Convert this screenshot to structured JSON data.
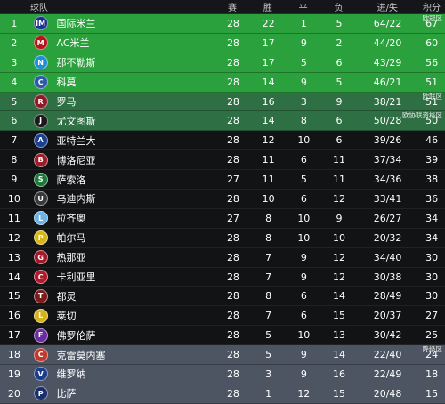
{
  "header": {
    "team": "球队",
    "played": "赛",
    "win": "胜",
    "draw": "平",
    "loss": "负",
    "goals": "进/失",
    "points": "积分"
  },
  "rows": [
    {
      "rank": "1",
      "team": "国际米兰",
      "p": "28",
      "w": "22",
      "d": "1",
      "l": "5",
      "gd": "64/22",
      "pts": "67",
      "zone": "cl",
      "tag": "欧冠区",
      "badge_color": "#1b2f8f",
      "badge_icon": "inter-badge-icon",
      "badge_glyph": "IM"
    },
    {
      "rank": "2",
      "team": "AC米兰",
      "p": "28",
      "w": "17",
      "d": "9",
      "l": "2",
      "gd": "44/20",
      "pts": "60",
      "zone": "cl",
      "tag": "",
      "badge_color": "#b3151b",
      "badge_icon": "milan-badge-icon",
      "badge_glyph": "M"
    },
    {
      "rank": "3",
      "team": "那不勒斯",
      "p": "28",
      "w": "17",
      "d": "5",
      "l": "6",
      "gd": "43/29",
      "pts": "56",
      "zone": "cl",
      "tag": "",
      "badge_color": "#1e8fd6",
      "badge_icon": "napoli-badge-icon",
      "badge_glyph": "N"
    },
    {
      "rank": "4",
      "team": "科莫",
      "p": "28",
      "w": "14",
      "d": "9",
      "l": "5",
      "gd": "46/21",
      "pts": "51",
      "zone": "cl",
      "tag": "",
      "badge_color": "#2a5aa8",
      "badge_icon": "como-badge-icon",
      "badge_glyph": "C"
    },
    {
      "rank": "5",
      "team": "罗马",
      "p": "28",
      "w": "16",
      "d": "3",
      "l": "9",
      "gd": "38/21",
      "pts": "51",
      "zone": "el",
      "tag": "欧联区",
      "badge_color": "#8c1c2a",
      "badge_icon": "roma-badge-icon",
      "badge_glyph": "R"
    },
    {
      "rank": "6",
      "team": "尤文图斯",
      "p": "28",
      "w": "14",
      "d": "8",
      "l": "6",
      "gd": "50/28",
      "pts": "50",
      "zone": "el",
      "tag": "欧协联资格区",
      "badge_color": "#1a1a1a",
      "badge_icon": "juventus-badge-icon",
      "badge_glyph": "J"
    },
    {
      "rank": "7",
      "team": "亚特兰大",
      "p": "28",
      "w": "12",
      "d": "10",
      "l": "6",
      "gd": "39/26",
      "pts": "46",
      "zone": "mid",
      "tag": "",
      "badge_color": "#1d3f8f",
      "badge_icon": "atalanta-badge-icon",
      "badge_glyph": "A"
    },
    {
      "rank": "8",
      "team": "博洛尼亚",
      "p": "28",
      "w": "11",
      "d": "6",
      "l": "11",
      "gd": "37/34",
      "pts": "39",
      "zone": "mid",
      "tag": "",
      "badge_color": "#9c1d2a",
      "badge_icon": "bologna-badge-icon",
      "badge_glyph": "B"
    },
    {
      "rank": "9",
      "team": "萨索洛",
      "p": "27",
      "w": "11",
      "d": "5",
      "l": "11",
      "gd": "34/36",
      "pts": "38",
      "zone": "mid",
      "tag": "",
      "badge_color": "#1d7a3a",
      "badge_icon": "sassuolo-badge-icon",
      "badge_glyph": "S"
    },
    {
      "rank": "10",
      "team": "乌迪内斯",
      "p": "28",
      "w": "10",
      "d": "6",
      "l": "12",
      "gd": "33/41",
      "pts": "36",
      "zone": "mid",
      "tag": "",
      "badge_color": "#3a3a3a",
      "badge_icon": "udinese-badge-icon",
      "badge_glyph": "U"
    },
    {
      "rank": "11",
      "team": "拉齐奥",
      "p": "27",
      "w": "8",
      "d": "10",
      "l": "9",
      "gd": "26/27",
      "pts": "34",
      "zone": "mid",
      "tag": "",
      "badge_color": "#6bb3e6",
      "badge_icon": "lazio-badge-icon",
      "badge_glyph": "L"
    },
    {
      "rank": "12",
      "team": "帕尔马",
      "p": "28",
      "w": "8",
      "d": "10",
      "l": "10",
      "gd": "20/32",
      "pts": "34",
      "zone": "mid",
      "tag": "",
      "badge_color": "#d9b51a",
      "badge_icon": "parma-badge-icon",
      "badge_glyph": "P"
    },
    {
      "rank": "13",
      "team": "热那亚",
      "p": "28",
      "w": "7",
      "d": "9",
      "l": "12",
      "gd": "34/40",
      "pts": "30",
      "zone": "mid",
      "tag": "",
      "badge_color": "#a3182a",
      "badge_icon": "genoa-badge-icon",
      "badge_glyph": "G"
    },
    {
      "rank": "14",
      "team": "卡利亚里",
      "p": "28",
      "w": "7",
      "d": "9",
      "l": "12",
      "gd": "30/38",
      "pts": "30",
      "zone": "mid",
      "tag": "",
      "badge_color": "#b01a2a",
      "badge_icon": "cagliari-badge-icon",
      "badge_glyph": "C"
    },
    {
      "rank": "15",
      "team": "都灵",
      "p": "28",
      "w": "8",
      "d": "6",
      "l": "14",
      "gd": "28/49",
      "pts": "30",
      "zone": "mid",
      "tag": "",
      "badge_color": "#7a1c1c",
      "badge_icon": "torino-badge-icon",
      "badge_glyph": "T"
    },
    {
      "rank": "16",
      "team": "莱切",
      "p": "28",
      "w": "7",
      "d": "6",
      "l": "15",
      "gd": "20/37",
      "pts": "27",
      "zone": "mid",
      "tag": "",
      "badge_color": "#d7b21c",
      "badge_icon": "lecce-badge-icon",
      "badge_glyph": "L"
    },
    {
      "rank": "17",
      "team": "佛罗伦萨",
      "p": "28",
      "w": "5",
      "d": "10",
      "l": "13",
      "gd": "30/42",
      "pts": "25",
      "zone": "mid",
      "tag": "",
      "badge_color": "#6b2ca3",
      "badge_icon": "fiorentina-badge-icon",
      "badge_glyph": "F"
    },
    {
      "rank": "18",
      "team": "克雷莫内塞",
      "p": "28",
      "w": "5",
      "d": "9",
      "l": "14",
      "gd": "22/40",
      "pts": "24",
      "zone": "rel",
      "tag": "降级区",
      "badge_color": "#c2392b",
      "badge_icon": "cremonese-badge-icon",
      "badge_glyph": "C"
    },
    {
      "rank": "19",
      "team": "维罗纳",
      "p": "28",
      "w": "3",
      "d": "9",
      "l": "16",
      "gd": "22/49",
      "pts": "18",
      "zone": "rel",
      "tag": "",
      "badge_color": "#1b3d8c",
      "badge_icon": "verona-badge-icon",
      "badge_glyph": "V"
    },
    {
      "rank": "20",
      "team": "比萨",
      "p": "28",
      "w": "1",
      "d": "12",
      "l": "15",
      "gd": "20/48",
      "pts": "15",
      "zone": "rel",
      "tag": "",
      "badge_color": "#1a2f6b",
      "badge_icon": "pisa-badge-icon",
      "badge_glyph": "P"
    }
  ]
}
